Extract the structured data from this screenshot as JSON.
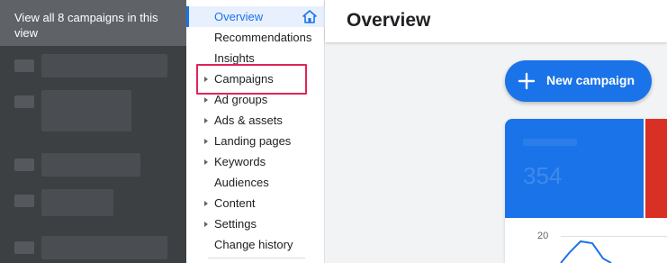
{
  "tooltip": {
    "text": "View all 8 campaigns in this view"
  },
  "nav": {
    "items": [
      {
        "label": "Overview",
        "active": true
      },
      {
        "label": "Recommendations"
      },
      {
        "label": "Insights"
      },
      {
        "label": "Campaigns",
        "expandable": true,
        "highlighted": true
      },
      {
        "label": "Ad groups",
        "expandable": true
      },
      {
        "label": "Ads & assets",
        "expandable": true
      },
      {
        "label": "Landing pages",
        "expandable": true
      },
      {
        "label": "Keywords",
        "expandable": true
      },
      {
        "label": "Audiences"
      },
      {
        "label": "Content",
        "expandable": true
      },
      {
        "label": "Settings",
        "expandable": true
      },
      {
        "label": "Change history"
      }
    ]
  },
  "header": {
    "title": "Overview"
  },
  "actions": {
    "new_campaign_label": "New campaign"
  },
  "card": {
    "faded_value": "354"
  },
  "chart_data": {
    "type": "line",
    "y_ticks": [
      "20"
    ]
  },
  "colors": {
    "accent": "#1a73e8",
    "highlight": "#e02459",
    "tile_red": "#d93025",
    "panel_dark": "#3c4043"
  },
  "icons": {
    "home": "home-icon",
    "plus": "plus-icon",
    "expand": "caret-right-icon"
  }
}
